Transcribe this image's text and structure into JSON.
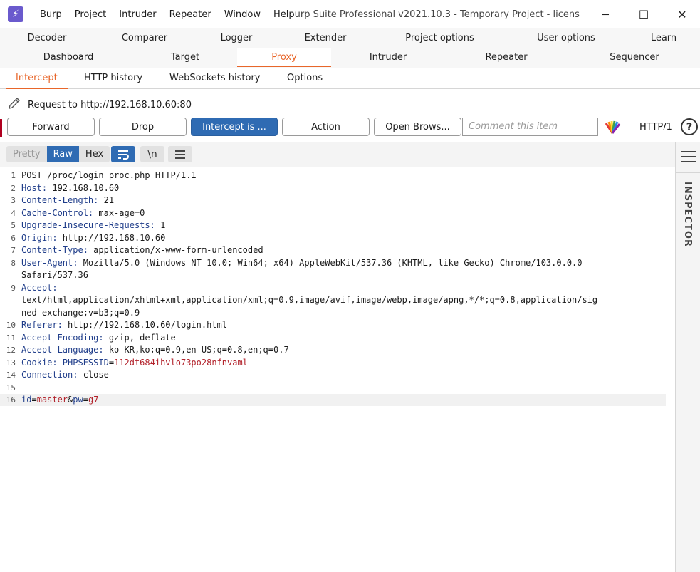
{
  "app": {
    "logo_glyph": "⚡",
    "menu": [
      "Burp",
      "Project",
      "Intruder",
      "Repeater",
      "Window",
      "Help"
    ],
    "title": "urp Suite Professional v2021.10.3 - Temporary Project - licens",
    "controls": [
      "─",
      "☐",
      "✕"
    ]
  },
  "tools": {
    "row1": [
      "Decoder",
      "Comparer",
      "Logger",
      "Extender",
      "Project options",
      "User options",
      "Learn"
    ],
    "row2": [
      "Dashboard",
      "Target",
      "Proxy",
      "Intruder",
      "Repeater",
      "Sequencer"
    ],
    "active": "Proxy"
  },
  "subtabs": [
    "Intercept",
    "HTTP history",
    "WebSockets history",
    "Options"
  ],
  "request": {
    "label": "Request to http://192.168.10.60:80"
  },
  "buttons": {
    "forward": "Forward",
    "drop": "Drop",
    "intercept": "Intercept is ...",
    "action": "Action",
    "open_browser": "Open Brows...",
    "comment_placeholder": "Comment this item",
    "http_version": "HTTP/1",
    "help": "?"
  },
  "editor_toolbar": {
    "modes": [
      "Pretty",
      "Raw",
      "Hex"
    ],
    "active_mode": "Raw",
    "newline_label": "\\n"
  },
  "inspector": {
    "label": "INSPECTOR"
  },
  "editor": {
    "lines": [
      {
        "n": "1",
        "key": "",
        "val": "POST /proc/login_proc.php HTTP/1.1"
      },
      {
        "n": "2",
        "key": "Host",
        "val": " 192.168.10.60"
      },
      {
        "n": "3",
        "key": "Content-Length",
        "val": " 21"
      },
      {
        "n": "4",
        "key": "Cache-Control",
        "val": " max-age=0"
      },
      {
        "n": "5",
        "key": "Upgrade-Insecure-Requests",
        "val": " 1"
      },
      {
        "n": "6",
        "key": "Origin",
        "val": " http://192.168.10.60"
      },
      {
        "n": "7",
        "key": "Content-Type",
        "val": " application/x-www-form-urlencoded"
      },
      {
        "n": "8",
        "key": "User-Agent",
        "val": " Mozilla/5.0 (Windows NT 10.0; Win64; x64) AppleWebKit/537.36 (KHTML, like Gecko) Chrome/103.0.0.0"
      },
      {
        "n": "",
        "key": "",
        "val": "Safari/537.36"
      },
      {
        "n": "9",
        "key": "Accept",
        "val": ""
      },
      {
        "n": "",
        "key": "",
        "val": "text/html,application/xhtml+xml,application/xml;q=0.9,image/avif,image/webp,image/apng,*/*;q=0.8,application/sig"
      },
      {
        "n": "",
        "key": "",
        "val": "ned-exchange;v=b3;q=0.9"
      },
      {
        "n": "10",
        "key": "Referer",
        "val": " http://192.168.10.60/login.html"
      },
      {
        "n": "11",
        "key": "Accept-Encoding",
        "val": " gzip, deflate"
      },
      {
        "n": "12",
        "key": "Accept-Language",
        "val": " ko-KR,ko;q=0.9,en-US;q=0.8,en;q=0.7"
      },
      {
        "n": "13",
        "key": "Cookie",
        "val": " PHPSESSID=112dt684ihvlo73po28nfnvaml"
      },
      {
        "n": "14",
        "key": "Connection",
        "val": " close"
      },
      {
        "n": "15",
        "key": "",
        "val": ""
      },
      {
        "n": "16",
        "key": "",
        "val": "id=master&pw=g7"
      }
    ]
  }
}
